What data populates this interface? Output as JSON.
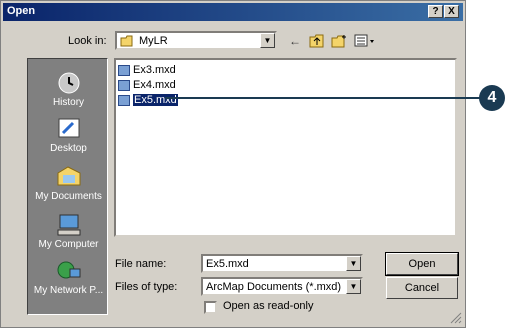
{
  "window": {
    "title": "Open",
    "help_btn": "?",
    "close_btn": "X"
  },
  "look_in": {
    "label": "Look in:",
    "value": "MyLR"
  },
  "places": [
    {
      "label": "History",
      "icon": "history-icon"
    },
    {
      "label": "Desktop",
      "icon": "desktop-icon"
    },
    {
      "label": "My Documents",
      "icon": "my-documents-icon"
    },
    {
      "label": "My Computer",
      "icon": "my-computer-icon"
    },
    {
      "label": "My Network P...",
      "icon": "my-network-places-icon"
    }
  ],
  "files": [
    {
      "name": "Ex3.mxd",
      "selected": false
    },
    {
      "name": "Ex4.mxd",
      "selected": false
    },
    {
      "name": "Ex5.mxd",
      "selected": true
    }
  ],
  "file_name": {
    "label": "File name:",
    "value": "Ex5.mxd"
  },
  "file_type": {
    "label": "Files of type:",
    "value": "ArcMap Documents (*.mxd)"
  },
  "read_only": {
    "label": "Open as read-only",
    "checked": false
  },
  "buttons": {
    "open": "Open",
    "cancel": "Cancel"
  },
  "callout": {
    "number": "4"
  },
  "colors": {
    "titlebar": "#0a246a",
    "callout": "#1a3a52",
    "selection": "#0a246a"
  }
}
